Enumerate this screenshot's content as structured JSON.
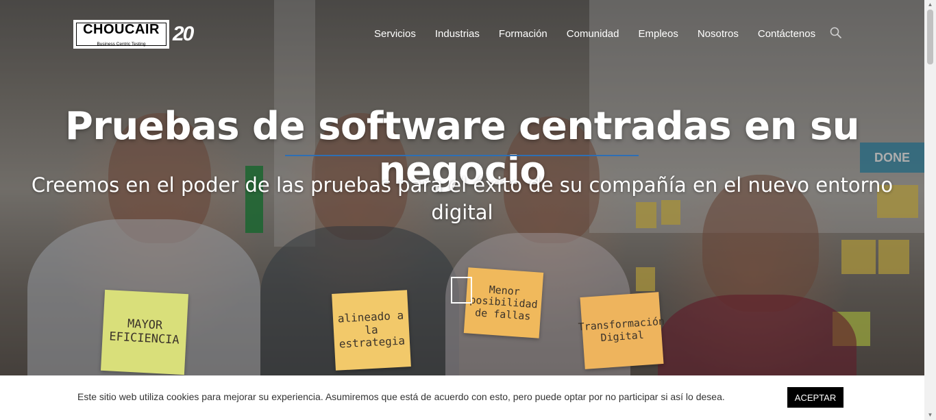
{
  "brand": {
    "logo_word": "CHOUCAIR",
    "logo_tagline": "Business Centric Testing",
    "anniversary": "20"
  },
  "nav": {
    "items": [
      "Servicios",
      "Industrias",
      "Formación",
      "Comunidad",
      "Empleos",
      "Nosotros",
      "Contáctenos"
    ],
    "search_icon": "search-icon"
  },
  "hero": {
    "headline": "Pruebas de software centradas en su negocio",
    "subheadline": "Creemos en el poder de las pruebas para el éxito de su compañía en el nuevo entorno digital",
    "notes": [
      "MAYOR EFICIENCIA",
      "alineado a la estrategia",
      "Menor posibilidad de fallas",
      "Transformación Digital"
    ],
    "wall_label": "DONE",
    "accent_color": "#2d6fb5"
  },
  "cookie": {
    "message": "Este sitio web utiliza cookies para mejorar su experiencia. Asumiremos que está de acuerdo con esto, pero puede optar por no participar si así lo desea.",
    "accept_label": "ACEPTAR"
  }
}
